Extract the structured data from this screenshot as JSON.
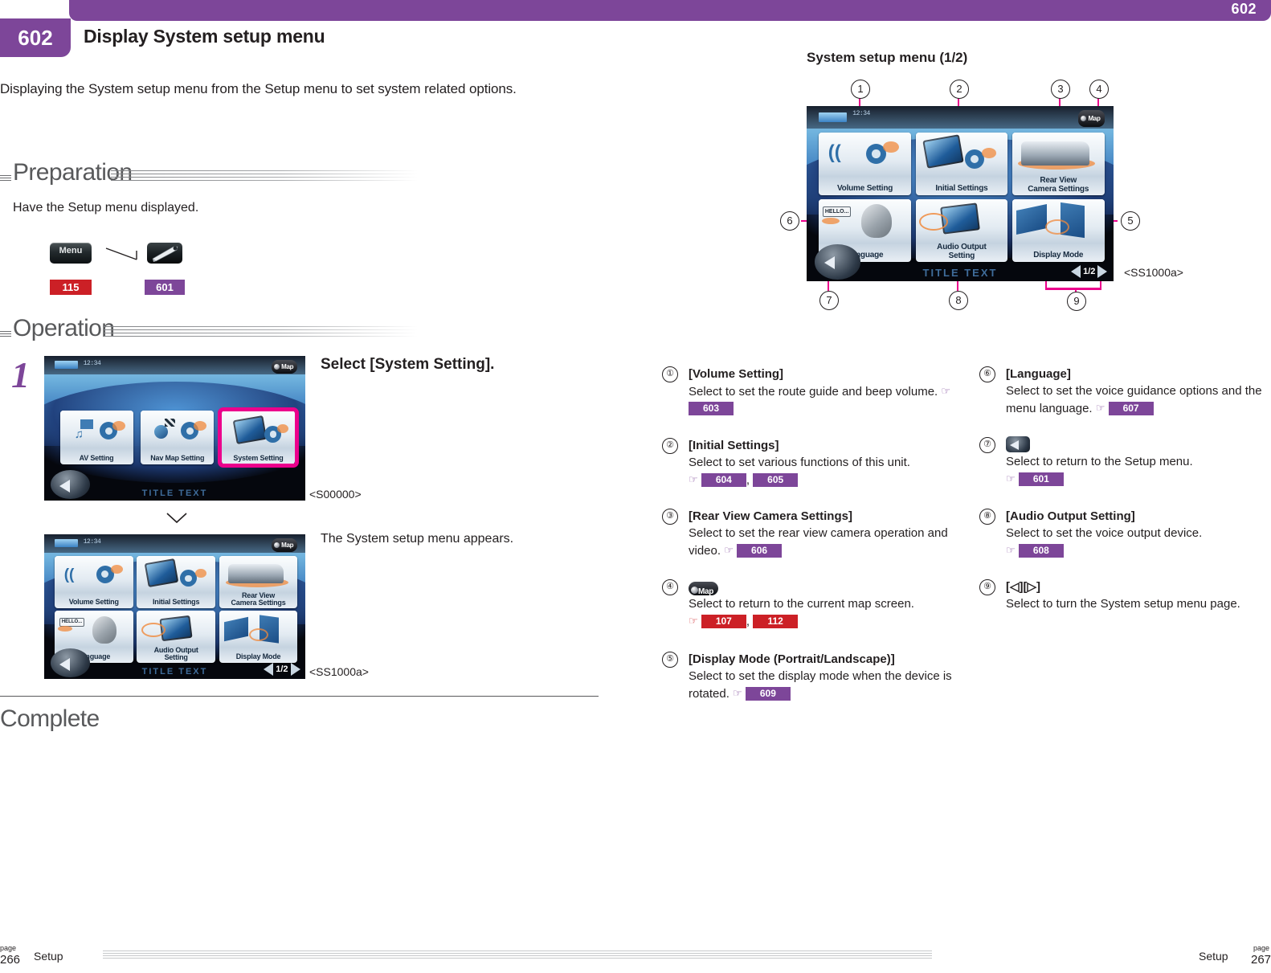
{
  "header": {
    "corner_number": "602",
    "tab_number": "602",
    "title": "Display System setup menu",
    "accent_color": "#7d4699"
  },
  "intro": "Displaying the System setup menu from the Setup menu to set system related options.",
  "sections": {
    "preparation": "Preparation",
    "operation": "Operation",
    "complete": "Complete"
  },
  "preparation": {
    "text": "Have the Setup menu displayed.",
    "menu_icon_label": "Menu",
    "menu_page_ref": "115",
    "wrench_page_ref": "601"
  },
  "step1": {
    "number": "1",
    "title": "Select [System Setting].",
    "note": "The System setup menu appears.",
    "screen1_code": "<S00000>",
    "screen2_code": "<SS1000a>"
  },
  "setup_screen": {
    "clock": "12:34",
    "map_label": "Map",
    "title_text": "TITLE TEXT",
    "tiles": [
      {
        "label": "AV Setting"
      },
      {
        "label": "Nav Map Setting"
      },
      {
        "label": "System Setting",
        "highlighted": true
      }
    ]
  },
  "system_screen": {
    "clock": "12:34",
    "map_label": "Map",
    "title_text": "TITLE TEXT",
    "page_indicator": "1/2",
    "tiles": [
      {
        "label": "Volume Setting"
      },
      {
        "label": "Initial Settings"
      },
      {
        "label": "Rear View\nCamera Settings",
        "line1": "Rear View",
        "line2": "Camera Settings"
      },
      {
        "label": "Language",
        "bubble": "HELLO..."
      },
      {
        "label": "Audio Output\nSetting",
        "line1": "Audio Output",
        "line2": "Setting"
      },
      {
        "label": "Display Mode"
      }
    ]
  },
  "right_panel": {
    "title": "System setup menu (1/2)",
    "screen_code": "<SS1000a>",
    "callouts": [
      "1",
      "2",
      "3",
      "4",
      "5",
      "6",
      "7",
      "8",
      "9"
    ]
  },
  "legend": {
    "left": [
      {
        "num": "①",
        "title": "[Volume Setting]",
        "body": "Select to set the route guide and beep volume.",
        "refs": [
          {
            "value": "603",
            "color": "purple"
          }
        ]
      },
      {
        "num": "②",
        "title": "[Initial Settings]",
        "body": "Select to set various functions of this unit.",
        "refs": [
          {
            "value": "604",
            "color": "purple"
          },
          {
            "value": "605",
            "color": "purple"
          }
        ]
      },
      {
        "num": "③",
        "title": "[Rear View Camera Settings]",
        "body": "Select to set the rear view camera operation and video.",
        "refs": [
          {
            "value": "606",
            "color": "purple"
          }
        ]
      },
      {
        "num": "④",
        "title": "",
        "icon": "map-button-icon",
        "icon_label": "Map",
        "body": "Select to return to the current map screen.",
        "refs": [
          {
            "value": "107",
            "color": "red"
          },
          {
            "value": "112",
            "color": "red"
          }
        ]
      },
      {
        "num": "⑤",
        "title": "[Display Mode (Portrait/Landscape)]",
        "body": "Select to set the display mode when the device is rotated.",
        "refs": [
          {
            "value": "609",
            "color": "purple"
          }
        ]
      }
    ],
    "right": [
      {
        "num": "⑥",
        "title": "[Language]",
        "body": "Select to set the voice guidance options and the menu language.",
        "refs": [
          {
            "value": "607",
            "color": "purple"
          }
        ]
      },
      {
        "num": "⑦",
        "title": "",
        "icon": "back-button-icon",
        "body": "Select to return to the Setup menu.",
        "refs": [
          {
            "value": "601",
            "color": "purple"
          }
        ]
      },
      {
        "num": "⑧",
        "title": "[Audio Output Setting]",
        "body": "Select to set the voice output device.",
        "refs": [
          {
            "value": "608",
            "color": "purple"
          }
        ]
      },
      {
        "num": "⑨",
        "title": "[◁][▷]",
        "body": "Select to turn the System setup menu page.",
        "refs": []
      }
    ]
  },
  "footer": {
    "left_page_label": "page",
    "left_page_number": "266",
    "left_section": "Setup",
    "right_section": "Setup",
    "right_page_label": "page",
    "right_page_number": "267"
  }
}
